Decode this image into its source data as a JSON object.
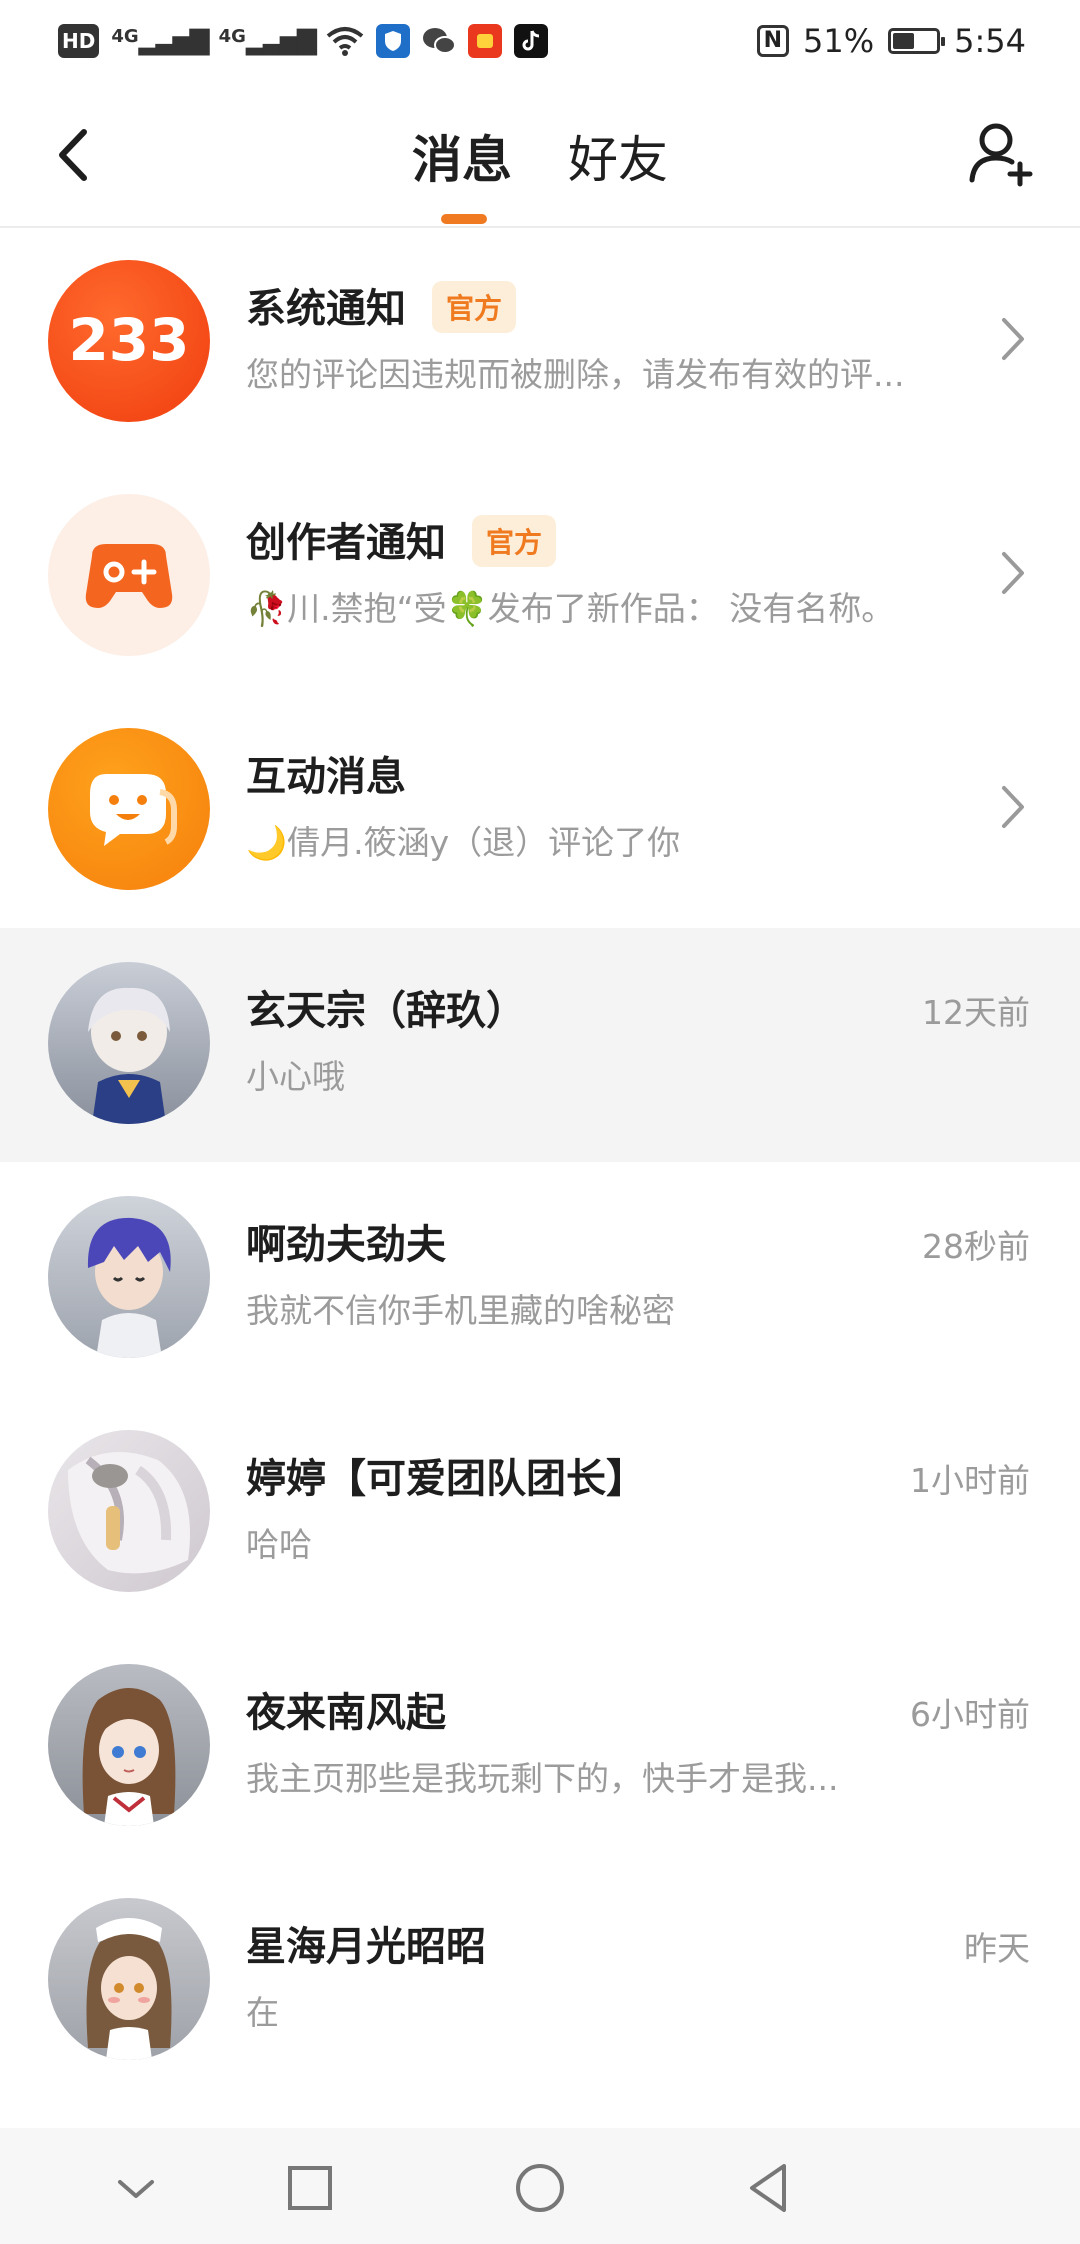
{
  "status_bar": {
    "left_labels": [
      "HD",
      "4G",
      "4G"
    ],
    "nfc_label": "N",
    "battery_text": "51%",
    "battery_level": 0.51,
    "time": "5:54"
  },
  "header": {
    "tabs": [
      {
        "label": "消息",
        "active": true
      },
      {
        "label": "好友",
        "active": false
      }
    ],
    "accent_color": "#f07a22"
  },
  "notifications": [
    {
      "title": "系统通知",
      "badge": "官方",
      "subtitle": "您的评论因违规而被删除，请发布有效的评...",
      "avatar_text": "233",
      "avatar_icon": "logo-233-icon"
    },
    {
      "title": "创作者通知",
      "badge": "官方",
      "subtitle": "🥀川.禁抱“受🍀发布了新作品：  没有名称。",
      "avatar_icon": "gamepad-icon"
    },
    {
      "title": "互动消息",
      "badge": "",
      "subtitle": "🌙倩月.筱涵y（退）评论了你",
      "avatar_icon": "chat-bubble-smile-icon"
    }
  ],
  "chats": [
    {
      "name": "玄天宗（辞玖）",
      "message": "小心哦",
      "time": "12天前",
      "highlighted": true
    },
    {
      "name": "啊劲夫劲夫",
      "message": "我就不信你手机里藏的啥秘密",
      "time": "28秒前",
      "highlighted": false
    },
    {
      "name": "婷婷【可爱团队团长】",
      "message": "哈哈",
      "time": "1小时前",
      "highlighted": false
    },
    {
      "name": "夜来南风起",
      "message": "我主页那些是我玩剩下的，快手才是我...",
      "time": "6小时前",
      "highlighted": false
    },
    {
      "name": "星海月光昭昭",
      "message": "在",
      "time": "昨天",
      "highlighted": false
    }
  ],
  "bottom_nav": [
    "chevron-down-icon",
    "recents-square-icon",
    "home-circle-icon",
    "back-triangle-icon"
  ]
}
